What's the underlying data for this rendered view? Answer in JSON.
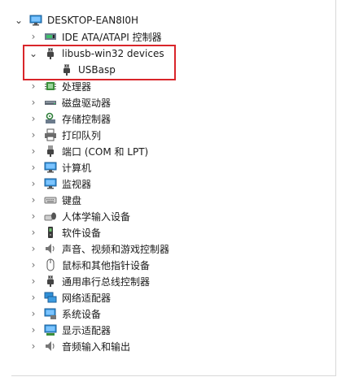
{
  "tree": {
    "root": {
      "label": "DESKTOP-EAN8I0H",
      "icon": "computer-icon"
    },
    "items": [
      {
        "label": "IDE ATA/ATAPI 控制器",
        "icon": "ide-controller-icon",
        "expanded": false
      },
      {
        "label": "libusb-win32 devices",
        "icon": "usb-plug-icon",
        "expanded": true,
        "children": [
          {
            "label": "USBasp",
            "icon": "usb-plug-icon"
          }
        ]
      },
      {
        "label": "处理器",
        "icon": "processor-icon",
        "expanded": false
      },
      {
        "label": "磁盘驱动器",
        "icon": "disk-drive-icon",
        "expanded": false
      },
      {
        "label": "存储控制器",
        "icon": "storage-controller-icon",
        "expanded": false
      },
      {
        "label": "打印队列",
        "icon": "printer-icon",
        "expanded": false
      },
      {
        "label": "端口 (COM 和 LPT)",
        "icon": "port-icon",
        "expanded": false
      },
      {
        "label": "计算机",
        "icon": "monitor-icon",
        "expanded": false
      },
      {
        "label": "监视器",
        "icon": "monitor-icon",
        "expanded": false
      },
      {
        "label": "键盘",
        "icon": "keyboard-icon",
        "expanded": false
      },
      {
        "label": "人体学输入设备",
        "icon": "hid-icon",
        "expanded": false
      },
      {
        "label": "软件设备",
        "icon": "software-device-icon",
        "expanded": false
      },
      {
        "label": "声音、视频和游戏控制器",
        "icon": "speaker-icon",
        "expanded": false
      },
      {
        "label": "鼠标和其他指针设备",
        "icon": "mouse-icon",
        "expanded": false
      },
      {
        "label": "通用串行总线控制器",
        "icon": "usb-plug-icon",
        "expanded": false
      },
      {
        "label": "网络适配器",
        "icon": "network-adapter-icon",
        "expanded": false
      },
      {
        "label": "系统设备",
        "icon": "system-device-icon",
        "expanded": false
      },
      {
        "label": "显示适配器",
        "icon": "display-adapter-icon",
        "expanded": false
      },
      {
        "label": "音频输入和输出",
        "icon": "audio-io-icon",
        "expanded": false
      }
    ]
  },
  "highlight_color": "#d9252a"
}
